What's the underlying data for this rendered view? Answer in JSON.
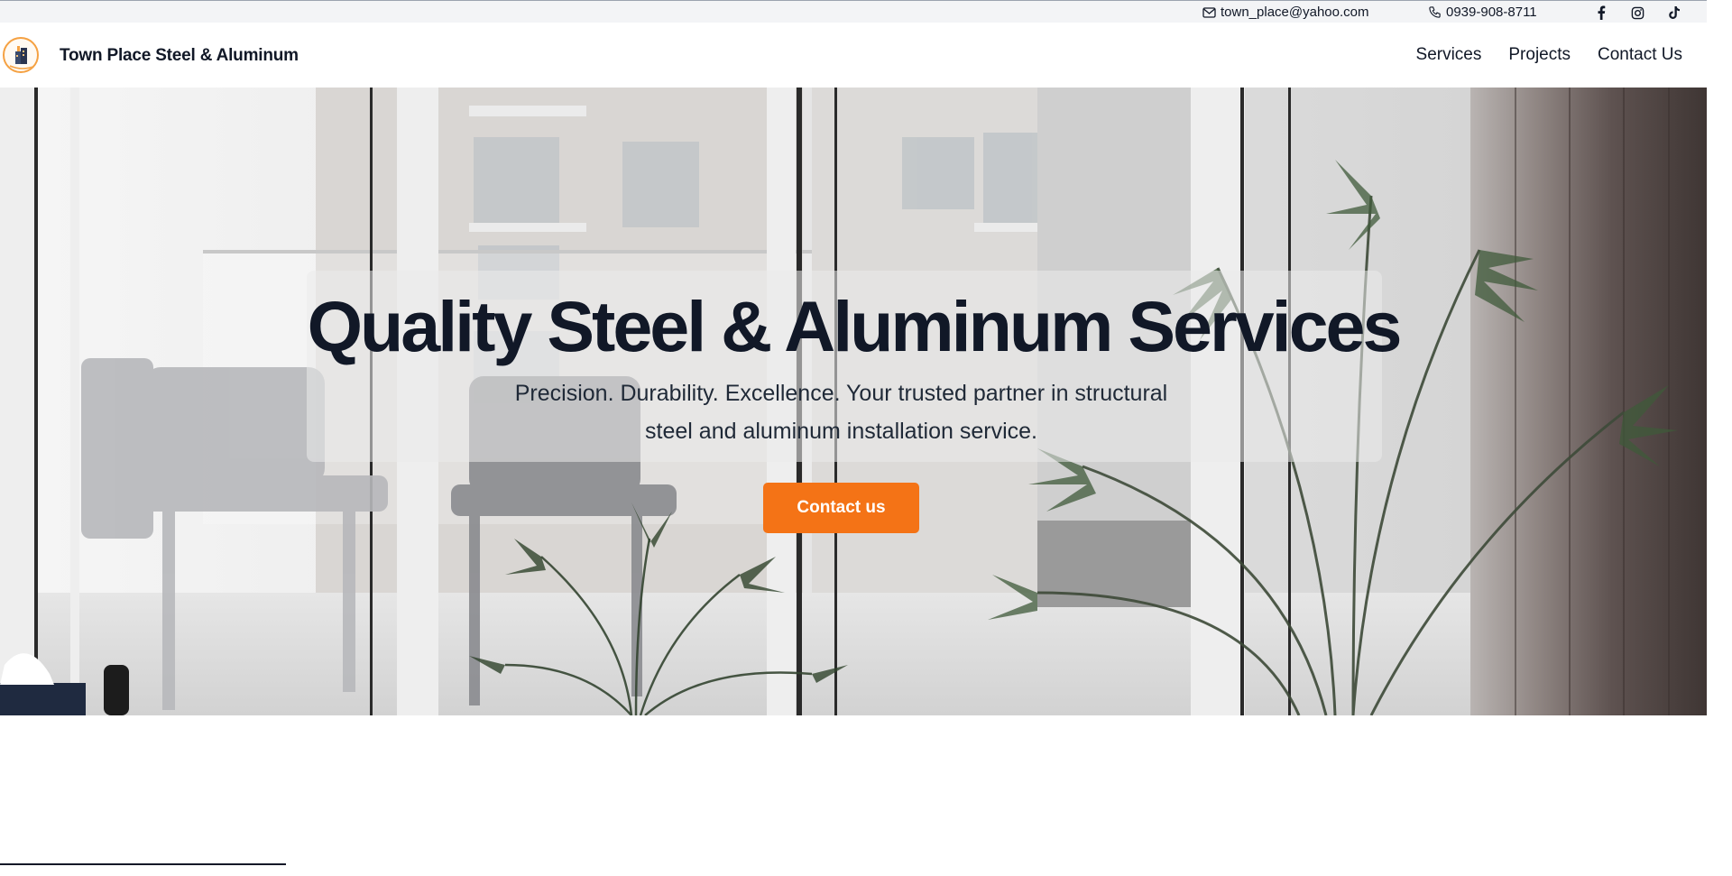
{
  "topbar": {
    "email": "town_place@yahoo.com",
    "phone": "0939-908-8711",
    "icons": [
      "mail-icon",
      "phone-icon",
      "facebook-icon",
      "instagram-icon",
      "tiktok-icon"
    ]
  },
  "header": {
    "brand": "Town Place Steel & Aluminum",
    "nav": [
      "Services",
      "Projects",
      "Contact Us"
    ]
  },
  "hero": {
    "title": "Quality Steel & Aluminum Services",
    "subtitle": "Precision. Durability. Excellence. Your trusted partner in structural steel and aluminum installation service.",
    "cta_label": "Contact us"
  },
  "colors": {
    "accent": "#f47316",
    "text": "#111827",
    "topbar_bg": "#f3f4f6"
  }
}
